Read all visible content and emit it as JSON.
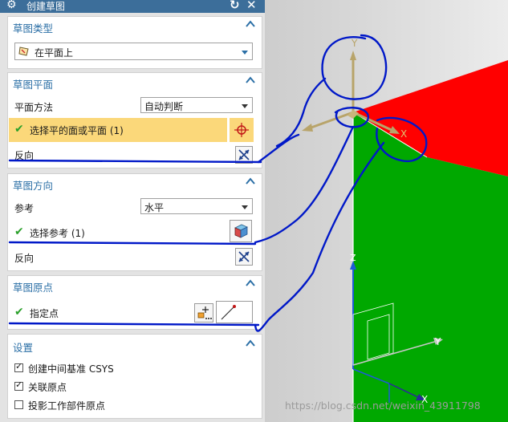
{
  "dialog": {
    "title": "创建草图",
    "settings_icon": "gear-icon",
    "reset_icon": "reset-icon",
    "close_icon": "close-icon"
  },
  "sketch_type": {
    "title": "草图类型",
    "value": "在平面上",
    "icon": "sketch-on-plane-icon"
  },
  "sketch_plane": {
    "title": "草图平面",
    "method_label": "平面方法",
    "method_value": "自动判断",
    "select_label": "选择平的面或平面 (1)",
    "select_highlight": "#fbd87a",
    "reverse_label": "反向"
  },
  "sketch_orientation": {
    "title": "草图方向",
    "reference_label": "参考",
    "reference_value": "水平",
    "select_label": "选择参考 (1)",
    "reverse_label": "反向"
  },
  "sketch_origin": {
    "title": "草图原点",
    "specify_point_label": "指定点"
  },
  "settings": {
    "title": "设置",
    "options": [
      {
        "label": "创建中间基准 CSYS",
        "checked": true
      },
      {
        "label": "关联原点",
        "checked": true
      },
      {
        "label": "投影工作部件原点",
        "checked": false
      }
    ]
  },
  "viewport": {
    "axis_y_label": "Y",
    "axis_x_label": "X",
    "axis_z_label": "Z",
    "wcs_y_label": "Y",
    "wcs_x_label": "X",
    "watermark": "https://blog.csdn.net/weixin_43911798",
    "colors": {
      "top_face": "#ff0000",
      "front_face": "#00a800",
      "axis": "#b8a46a",
      "annotation": "#0018c8"
    }
  }
}
